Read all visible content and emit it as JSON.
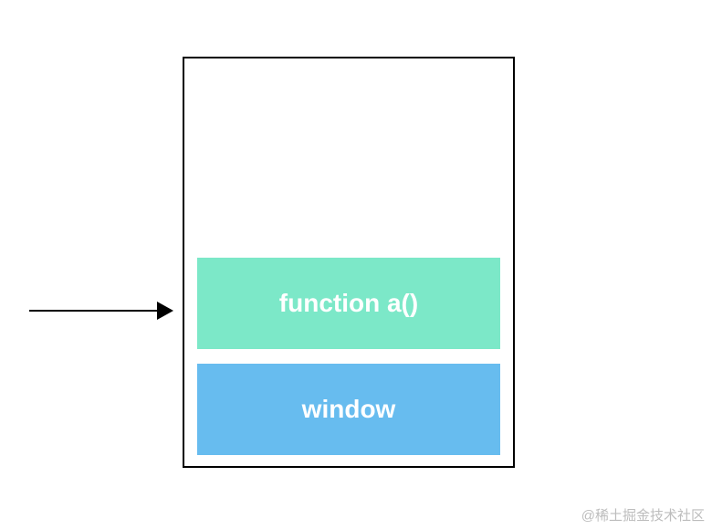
{
  "diagram": {
    "stack": {
      "items": [
        {
          "label": "function a()",
          "color": "#7ce8c8"
        },
        {
          "label": "window",
          "color": "#67bcef"
        }
      ]
    },
    "arrow": {
      "direction": "right",
      "points_to": "function a()"
    }
  },
  "watermark": "@稀土掘金技术社区"
}
